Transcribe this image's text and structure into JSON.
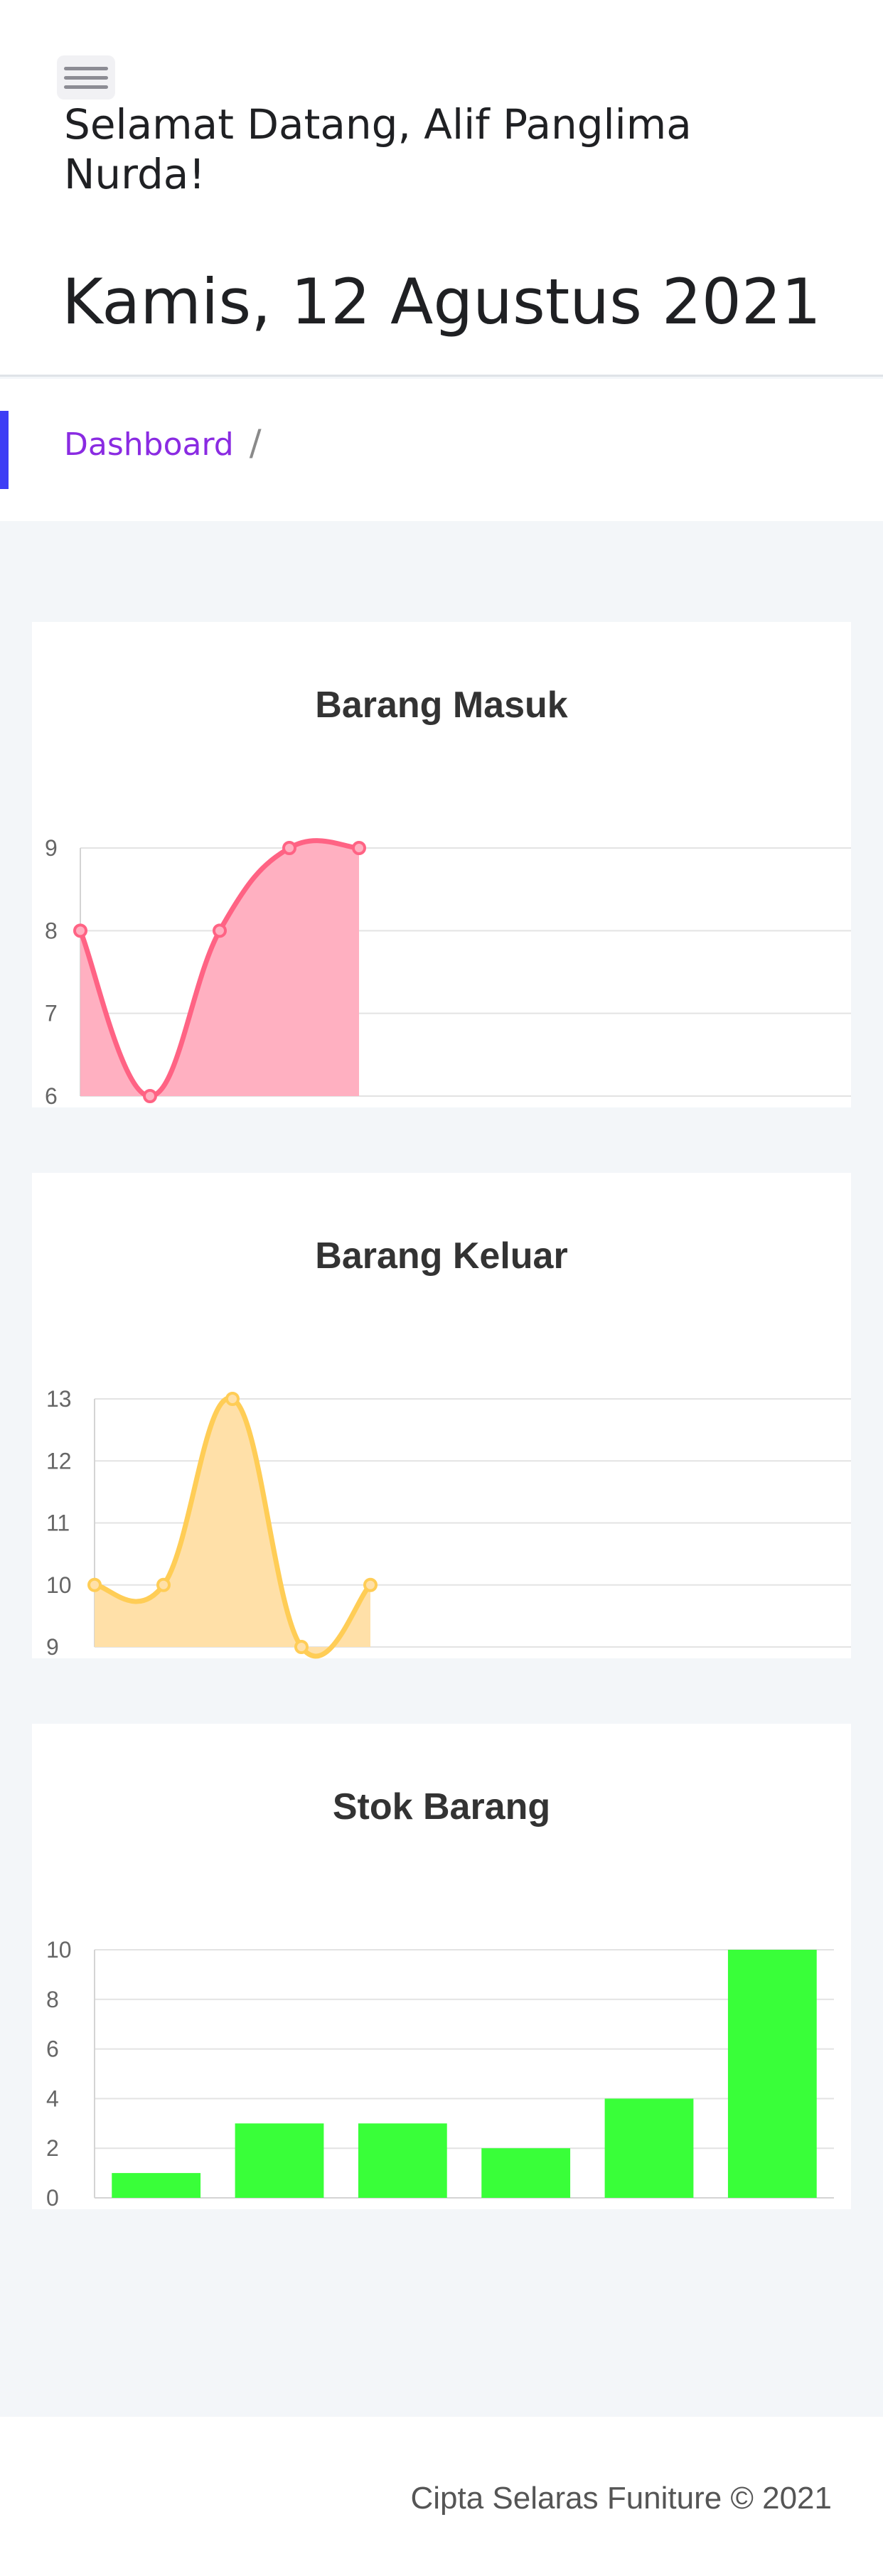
{
  "header": {
    "welcome": "Selamat Datang, Alif Panglima Nurda!",
    "date": "Kamis, 12 Agustus 2021"
  },
  "breadcrumb": {
    "items": [
      "Dashboard"
    ],
    "separator": "/"
  },
  "colors": {
    "accent": "#3d3df5",
    "link": "#8a2be2",
    "masuk_line": "#ff6384",
    "masuk_fill": "#ffb0c1",
    "keluar_line": "#ffcd56",
    "keluar_fill": "#ffe0a8",
    "stok_bar": "#39ff39"
  },
  "footer": {
    "text": "Cipta Selaras Funiture © 2021"
  },
  "chart_data": [
    {
      "id": "masuk",
      "type": "line",
      "title": "Barang Masuk",
      "x": [
        0,
        1,
        2,
        3,
        4
      ],
      "values": [
        8,
        6,
        8,
        9,
        9
      ],
      "ylim": [
        6,
        9
      ],
      "yticks": [
        6,
        7,
        8,
        9
      ],
      "fill": true,
      "grid": true
    },
    {
      "id": "keluar",
      "type": "line",
      "title": "Barang Keluar",
      "x": [
        0,
        1,
        2,
        3,
        4
      ],
      "values": [
        10,
        10,
        13,
        9,
        10
      ],
      "ylim": [
        9,
        13
      ],
      "yticks": [
        9,
        10,
        11,
        12,
        13
      ],
      "fill": true,
      "grid": true
    },
    {
      "id": "stok",
      "type": "bar",
      "title": "Stok Barang",
      "values": [
        1,
        3,
        3,
        2,
        4,
        10
      ],
      "ylim": [
        0,
        10
      ],
      "yticks": [
        0,
        2,
        4,
        6,
        8,
        10
      ],
      "grid": true
    }
  ]
}
